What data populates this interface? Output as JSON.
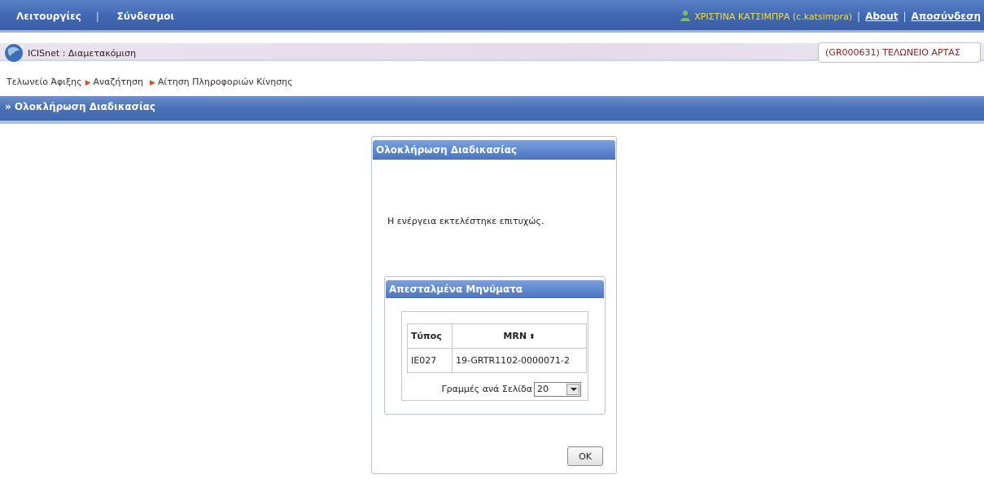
{
  "topbar": {
    "menu_functions": "Λειτουργίες",
    "menu_links": "Σύνδεσμοι",
    "separator": "|",
    "user_name": "ΧΡΙΣΤΙΝΑ ΚΑΤΣΙΜΠΡΑ (c.katsimpra)",
    "about_label": "About",
    "logout_label": "Αποσύνδεση",
    "user_color": "#f5e23a"
  },
  "appbar": {
    "title": "ICISnet : Διαμετακόμιση",
    "office": "(GR000631) ΤΕΛΩΝΕΙΟ ΑΡΤΑΣ"
  },
  "breadcrumb": {
    "items": [
      "Τελωνείο Άφιξης",
      "Αναζήτηση",
      "Αίτηση Πληροφοριών Κίνησης"
    ]
  },
  "section": {
    "title": "» Ολοκλήρωση Διαδικασίας"
  },
  "dialog": {
    "title": "Ολοκλήρωση Διαδικασίας",
    "message": "Η ενέργεια εκτελέστηκε επιτυχώς.",
    "sent_messages": {
      "title": "Απεσταλμένα Μηνύματα",
      "columns": [
        "Τύπος",
        "MRN"
      ],
      "rows": [
        {
          "type": "IE027",
          "mrn": "19-GRTR1102-0000071-2"
        }
      ],
      "rows_per_page_label": "Γραμμές ανά Σελίδα",
      "rows_per_page_value": "20"
    },
    "ok_label": "OK"
  }
}
